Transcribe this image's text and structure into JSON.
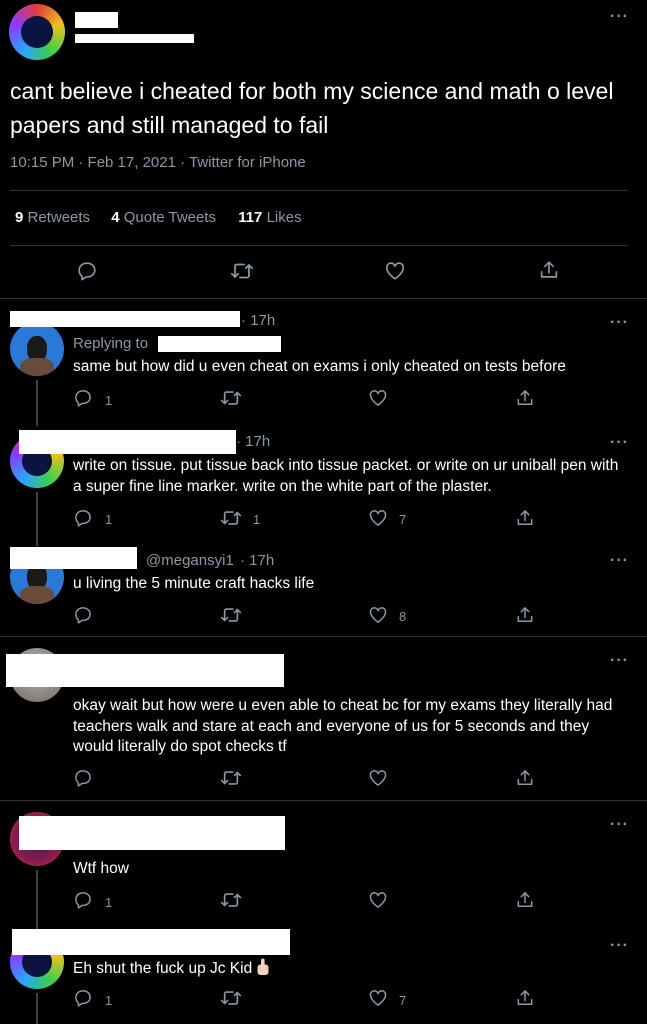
{
  "main_tweet": {
    "text": "cant believe i cheated for both my science and math o level papers and still managed to fail",
    "timestamp": "10:15 PM · Feb 17, 2021 · Twitter for iPhone",
    "stats": [
      {
        "count": "9",
        "label": "Retweets"
      },
      {
        "count": "4",
        "label": "Quote Tweets"
      },
      {
        "count": "117",
        "label": "Likes"
      }
    ]
  },
  "replies": [
    {
      "time": "· 17h",
      "replying_label": "Replying to",
      "text": "same but how did u even cheat on exams  i only cheated on tests before",
      "reply_count": "1",
      "retweet_count": "",
      "like_count": ""
    },
    {
      "time": "· 17h",
      "text": "write on tissue. put tissue back into tissue packet. or write on ur uniball pen with a super fine line marker. write on the white part of the plaster.",
      "reply_count": "1",
      "retweet_count": "1",
      "like_count": "7"
    },
    {
      "handle": "@megansyi1",
      "time": "· 17h",
      "text": "u living the 5 minute craft hacks life",
      "reply_count": "",
      "retweet_count": "",
      "like_count": "8"
    },
    {
      "text": "okay wait but how were u even able to cheat bc for my exams they literally had teachers walk and stare at each and everyone of us for 5 seconds and they would literally do spot checks tf",
      "reply_count": "",
      "retweet_count": "",
      "like_count": ""
    },
    {
      "text": "Wtf how",
      "reply_count": "1",
      "retweet_count": "",
      "like_count": ""
    },
    {
      "text": "Eh shut the fuck up Jc Kid",
      "reply_count": "1",
      "retweet_count": "",
      "like_count": "7"
    }
  ],
  "icons": [
    "more-icon",
    "reply-icon",
    "retweet-icon",
    "like-icon",
    "share-icon",
    "middle-finger-emoji"
  ],
  "colors": {
    "background": "#000000",
    "text": "#ffffff",
    "muted": "#8b98a5",
    "divider": "#2f3336"
  }
}
